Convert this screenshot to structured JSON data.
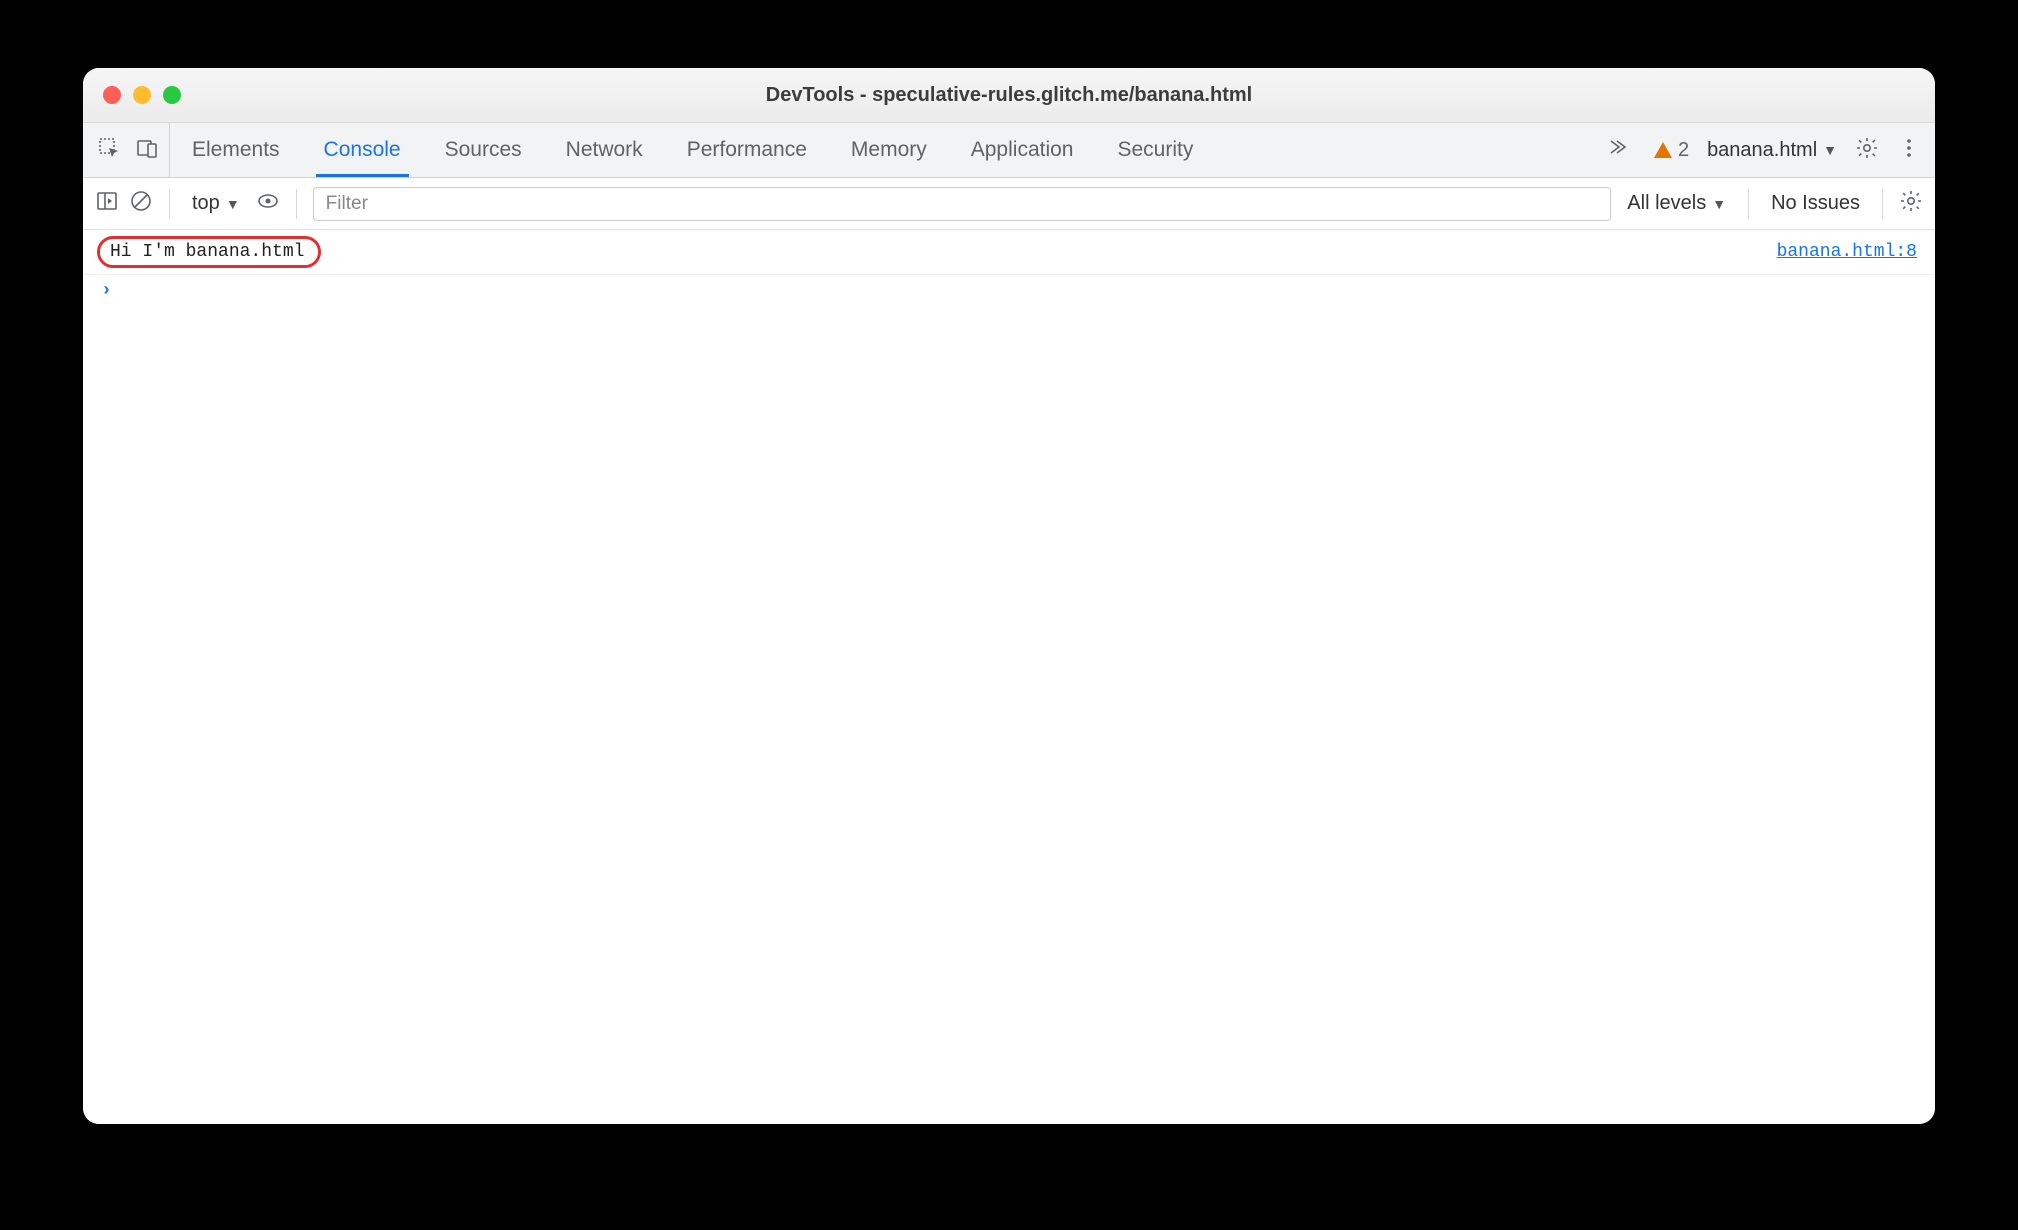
{
  "window": {
    "title": "DevTools - speculative-rules.glitch.me/banana.html"
  },
  "tabs": {
    "items": [
      "Elements",
      "Console",
      "Sources",
      "Network",
      "Performance",
      "Memory",
      "Application",
      "Security"
    ],
    "active_index": 1
  },
  "tabbar_right": {
    "warning_count": "2",
    "frame_context": "banana.html"
  },
  "console_toolbar": {
    "context": "top",
    "filter_placeholder": "Filter",
    "filter_value": "",
    "levels_label": "All levels",
    "issues_label": "No Issues"
  },
  "console": {
    "logs": [
      {
        "message": "Hi I'm banana.html",
        "source": "banana.html:8",
        "highlighted": true
      }
    ]
  }
}
